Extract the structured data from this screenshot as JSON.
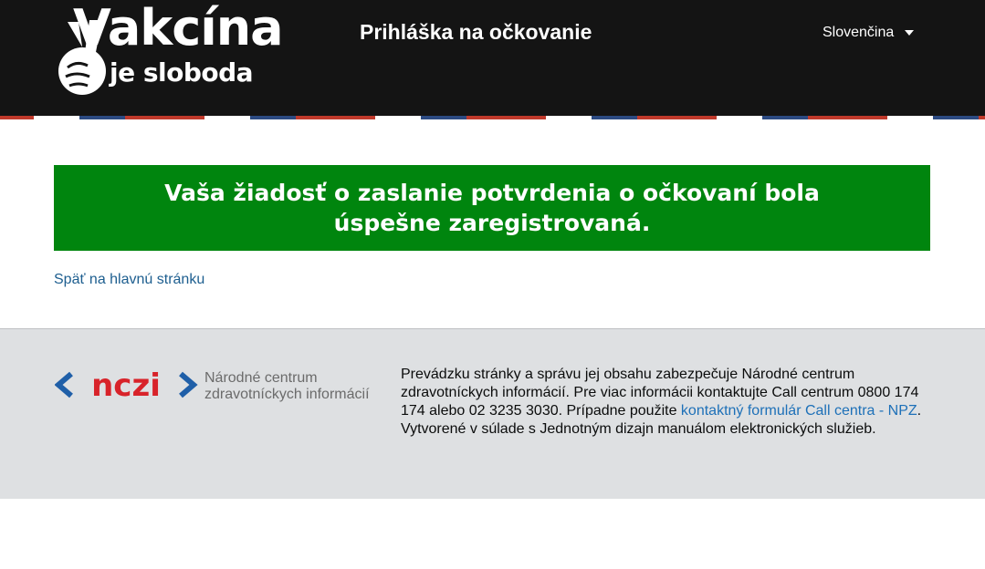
{
  "header": {
    "logo_main": "Vakcína",
    "logo_sub": "je sloboda",
    "title": "Prihláška na očkovanie",
    "language": "Slovenčina"
  },
  "banner": {
    "message": "Vaša žiadosť o zaslanie potvrdenia o očkovaní bola úspešne zaregistrovaná."
  },
  "back_link": "Späť na hlavnú stránku",
  "footer": {
    "org_logo": "nczi",
    "org_name_line1": "Národné centrum",
    "org_name_line2": "zdravotníckych informácií",
    "text_part1": "Prevádzku stránky a správu jej obsahu zabezpečuje Národné centrum zdravotníckych informácií. Pre viac informácii kontaktujte Call centrum 0800 174 174 alebo 02 3235 3030. Prípadne použite ",
    "contact_link": "kontaktný formulár Call centra - NPZ",
    "text_part2": ".",
    "text_line2": "Vytvorené v súlade s Jednotným dizajn manuálom elektronických služieb."
  },
  "colors": {
    "header_bg": "#141414",
    "banner_green": "#00850e",
    "link_blue": "#1d5e8f",
    "footer_bg": "#dee0e2",
    "nczi_red": "#d8232a",
    "nczi_blue": "#1f5fa8"
  }
}
